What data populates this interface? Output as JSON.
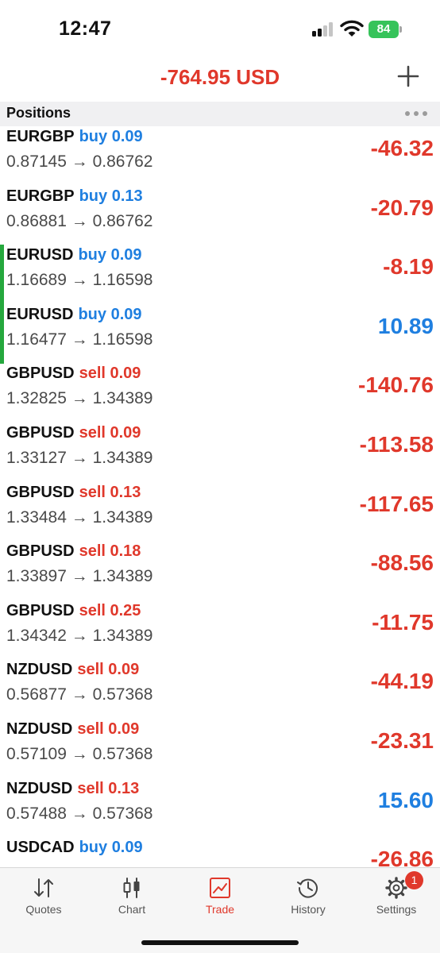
{
  "status_bar": {
    "time": "12:47",
    "battery": "84"
  },
  "header": {
    "balance": "-764.95 USD"
  },
  "section": {
    "title": "Positions"
  },
  "positions": [
    {
      "symbol": "EURGBP",
      "side": "buy",
      "volume": "0.09",
      "prices": "0.87145 → 0.86762",
      "profit": "-46.32"
    },
    {
      "symbol": "EURGBP",
      "side": "buy",
      "volume": "0.13",
      "prices": "0.86881 → 0.86762",
      "profit": "-20.79"
    },
    {
      "symbol": "EURUSD",
      "side": "buy",
      "volume": "0.09",
      "prices": "1.16689 → 1.16598",
      "profit": "-8.19",
      "highlighted": true
    },
    {
      "symbol": "EURUSD",
      "side": "buy",
      "volume": "0.09",
      "prices": "1.16477 → 1.16598",
      "profit": "10.89",
      "highlighted": true
    },
    {
      "symbol": "GBPUSD",
      "side": "sell",
      "volume": "0.09",
      "prices": "1.32825 → 1.34389",
      "profit": "-140.76"
    },
    {
      "symbol": "GBPUSD",
      "side": "sell",
      "volume": "0.09",
      "prices": "1.33127 → 1.34389",
      "profit": "-113.58"
    },
    {
      "symbol": "GBPUSD",
      "side": "sell",
      "volume": "0.13",
      "prices": "1.33484 → 1.34389",
      "profit": "-117.65"
    },
    {
      "symbol": "GBPUSD",
      "side": "sell",
      "volume": "0.18",
      "prices": "1.33897 → 1.34389",
      "profit": "-88.56"
    },
    {
      "symbol": "GBPUSD",
      "side": "sell",
      "volume": "0.25",
      "prices": "1.34342 → 1.34389",
      "profit": "-11.75"
    },
    {
      "symbol": "NZDUSD",
      "side": "sell",
      "volume": "0.09",
      "prices": "0.56877 → 0.57368",
      "profit": "-44.19"
    },
    {
      "symbol": "NZDUSD",
      "side": "sell",
      "volume": "0.09",
      "prices": "0.57109 → 0.57368",
      "profit": "-23.31"
    },
    {
      "symbol": "NZDUSD",
      "side": "sell",
      "volume": "0.13",
      "prices": "0.57488 → 0.57368",
      "profit": "15.60"
    },
    {
      "symbol": "USDCAD",
      "side": "buy",
      "volume": "0.09",
      "prices": "",
      "profit": "-26.86"
    }
  ],
  "tabs": [
    {
      "label": "Quotes",
      "icon": "quotes-arrows-icon"
    },
    {
      "label": "Chart",
      "icon": "candlestick-icon"
    },
    {
      "label": "Trade",
      "icon": "trade-chart-icon",
      "active": true
    },
    {
      "label": "History",
      "icon": "history-clock-icon"
    },
    {
      "label": "Settings",
      "icon": "gear-icon",
      "badge": "1"
    }
  ],
  "colors": {
    "negative": "#e0382b",
    "positive": "#1f7fe0",
    "buy": "#1f7fe0",
    "sell": "#e0382b",
    "highlight": "#25a83d"
  }
}
